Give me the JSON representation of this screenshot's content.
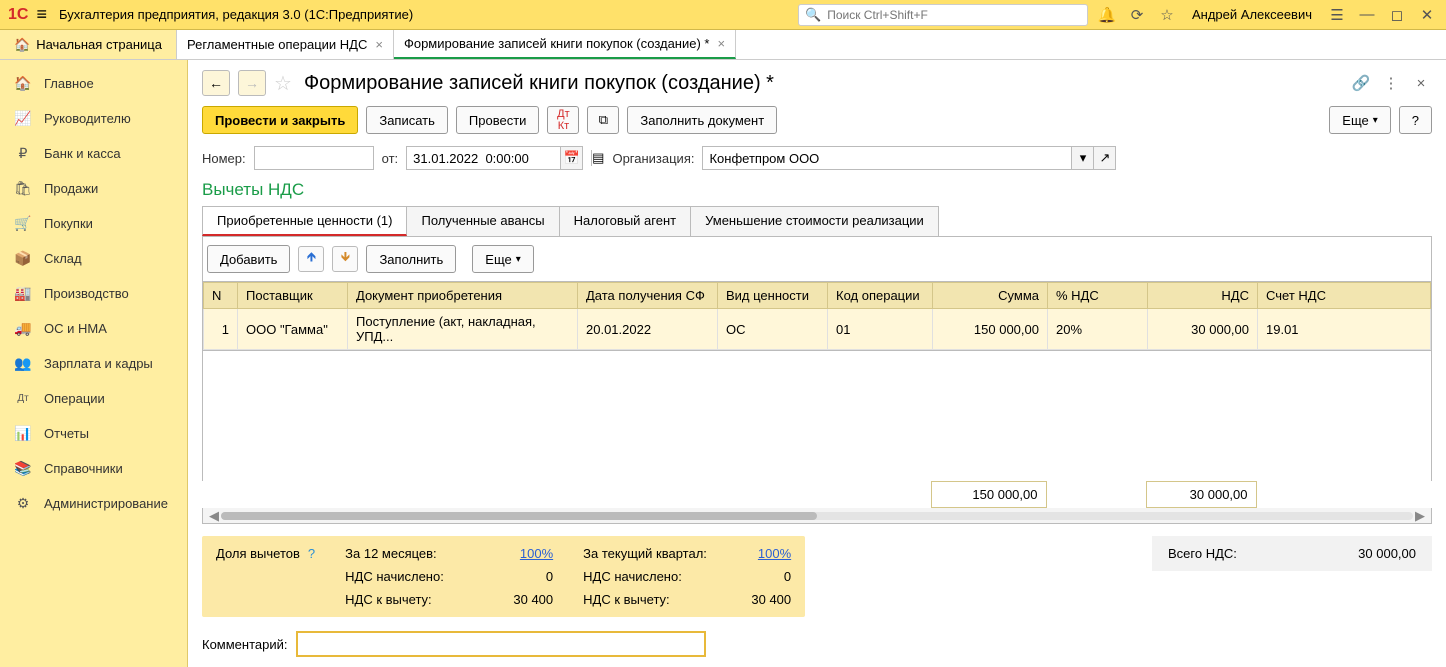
{
  "topbar": {
    "app_title": "Бухгалтерия предприятия, редакция 3.0  (1С:Предприятие)",
    "search_placeholder": "Поиск Ctrl+Shift+F",
    "user_name": "Андрей Алексеевич"
  },
  "tabs": {
    "home": "Начальная страница",
    "items": [
      {
        "label": "Регламентные операции НДС"
      },
      {
        "label": "Формирование записей книги покупок (создание) *"
      }
    ]
  },
  "sidebar": {
    "items": [
      {
        "icon": "🏠",
        "label": "Главное"
      },
      {
        "icon": "📈",
        "label": "Руководителю"
      },
      {
        "icon": "₽",
        "label": "Банк и касса"
      },
      {
        "icon": "🛍",
        "label": "Продажи"
      },
      {
        "icon": "🛒",
        "label": "Покупки"
      },
      {
        "icon": "📦",
        "label": "Склад"
      },
      {
        "icon": "🏭",
        "label": "Производство"
      },
      {
        "icon": "🚚",
        "label": "ОС и НМА"
      },
      {
        "icon": "👥",
        "label": "Зарплата и кадры"
      },
      {
        "icon": "Дт",
        "label": "Операции"
      },
      {
        "icon": "📊",
        "label": "Отчеты"
      },
      {
        "icon": "📚",
        "label": "Справочники"
      },
      {
        "icon": "⚙",
        "label": "Администрирование"
      }
    ]
  },
  "page": {
    "title": "Формирование записей книги покупок (создание) *",
    "buttons": {
      "submit_close": "Провести и закрыть",
      "save": "Записать",
      "submit": "Провести",
      "fill_doc": "Заполнить документ",
      "more": "Еще",
      "help": "?"
    },
    "form": {
      "number_label": "Номер:",
      "number_value": "",
      "from_label": "от:",
      "date_value": "31.01.2022  0:00:00",
      "org_label": "Организация:",
      "org_value": "Конфетпром ООО"
    },
    "section_title": "Вычеты НДС",
    "subtabs": [
      "Приобретенные ценности (1)",
      "Полученные авансы",
      "Налоговый агент",
      "Уменьшение стоимости реализации"
    ],
    "inner": {
      "add": "Добавить",
      "fill": "Заполнить",
      "more": "Еще"
    },
    "table": {
      "headers": [
        "N",
        "Поставщик",
        "Документ приобретения",
        "Дата получения СФ",
        "Вид ценности",
        "Код операции",
        "Сумма",
        "% НДС",
        "НДС",
        "Счет НДС"
      ],
      "rows": [
        {
          "n": "1",
          "supplier": "ООО \"Гамма\"",
          "doc": "Поступление (акт, накладная, УПД...",
          "date": "20.01.2022",
          "kind": "ОС",
          "code": "01",
          "sum": "150 000,00",
          "rate": "20%",
          "nds": "30 000,00",
          "acct": "19.01"
        }
      ],
      "totals": {
        "sum": "150 000,00",
        "nds": "30 000,00"
      }
    },
    "footer": {
      "share_label": "Доля вычетов",
      "twelve": {
        "title": "За 12 месяцев:",
        "percent": "100%",
        "charged_label": "НДС начислено:",
        "charged": "0",
        "deduct_label": "НДС к вычету:",
        "deduct": "30 400"
      },
      "quarter": {
        "title": "За текущий квартал:",
        "percent": "100%",
        "charged_label": "НДС начислено:",
        "charged": "0",
        "deduct_label": "НДС к вычету:",
        "deduct": "30 400"
      },
      "total_label": "Всего НДС:",
      "total_value": "30 000,00"
    },
    "comment_label": "Комментарий:"
  }
}
